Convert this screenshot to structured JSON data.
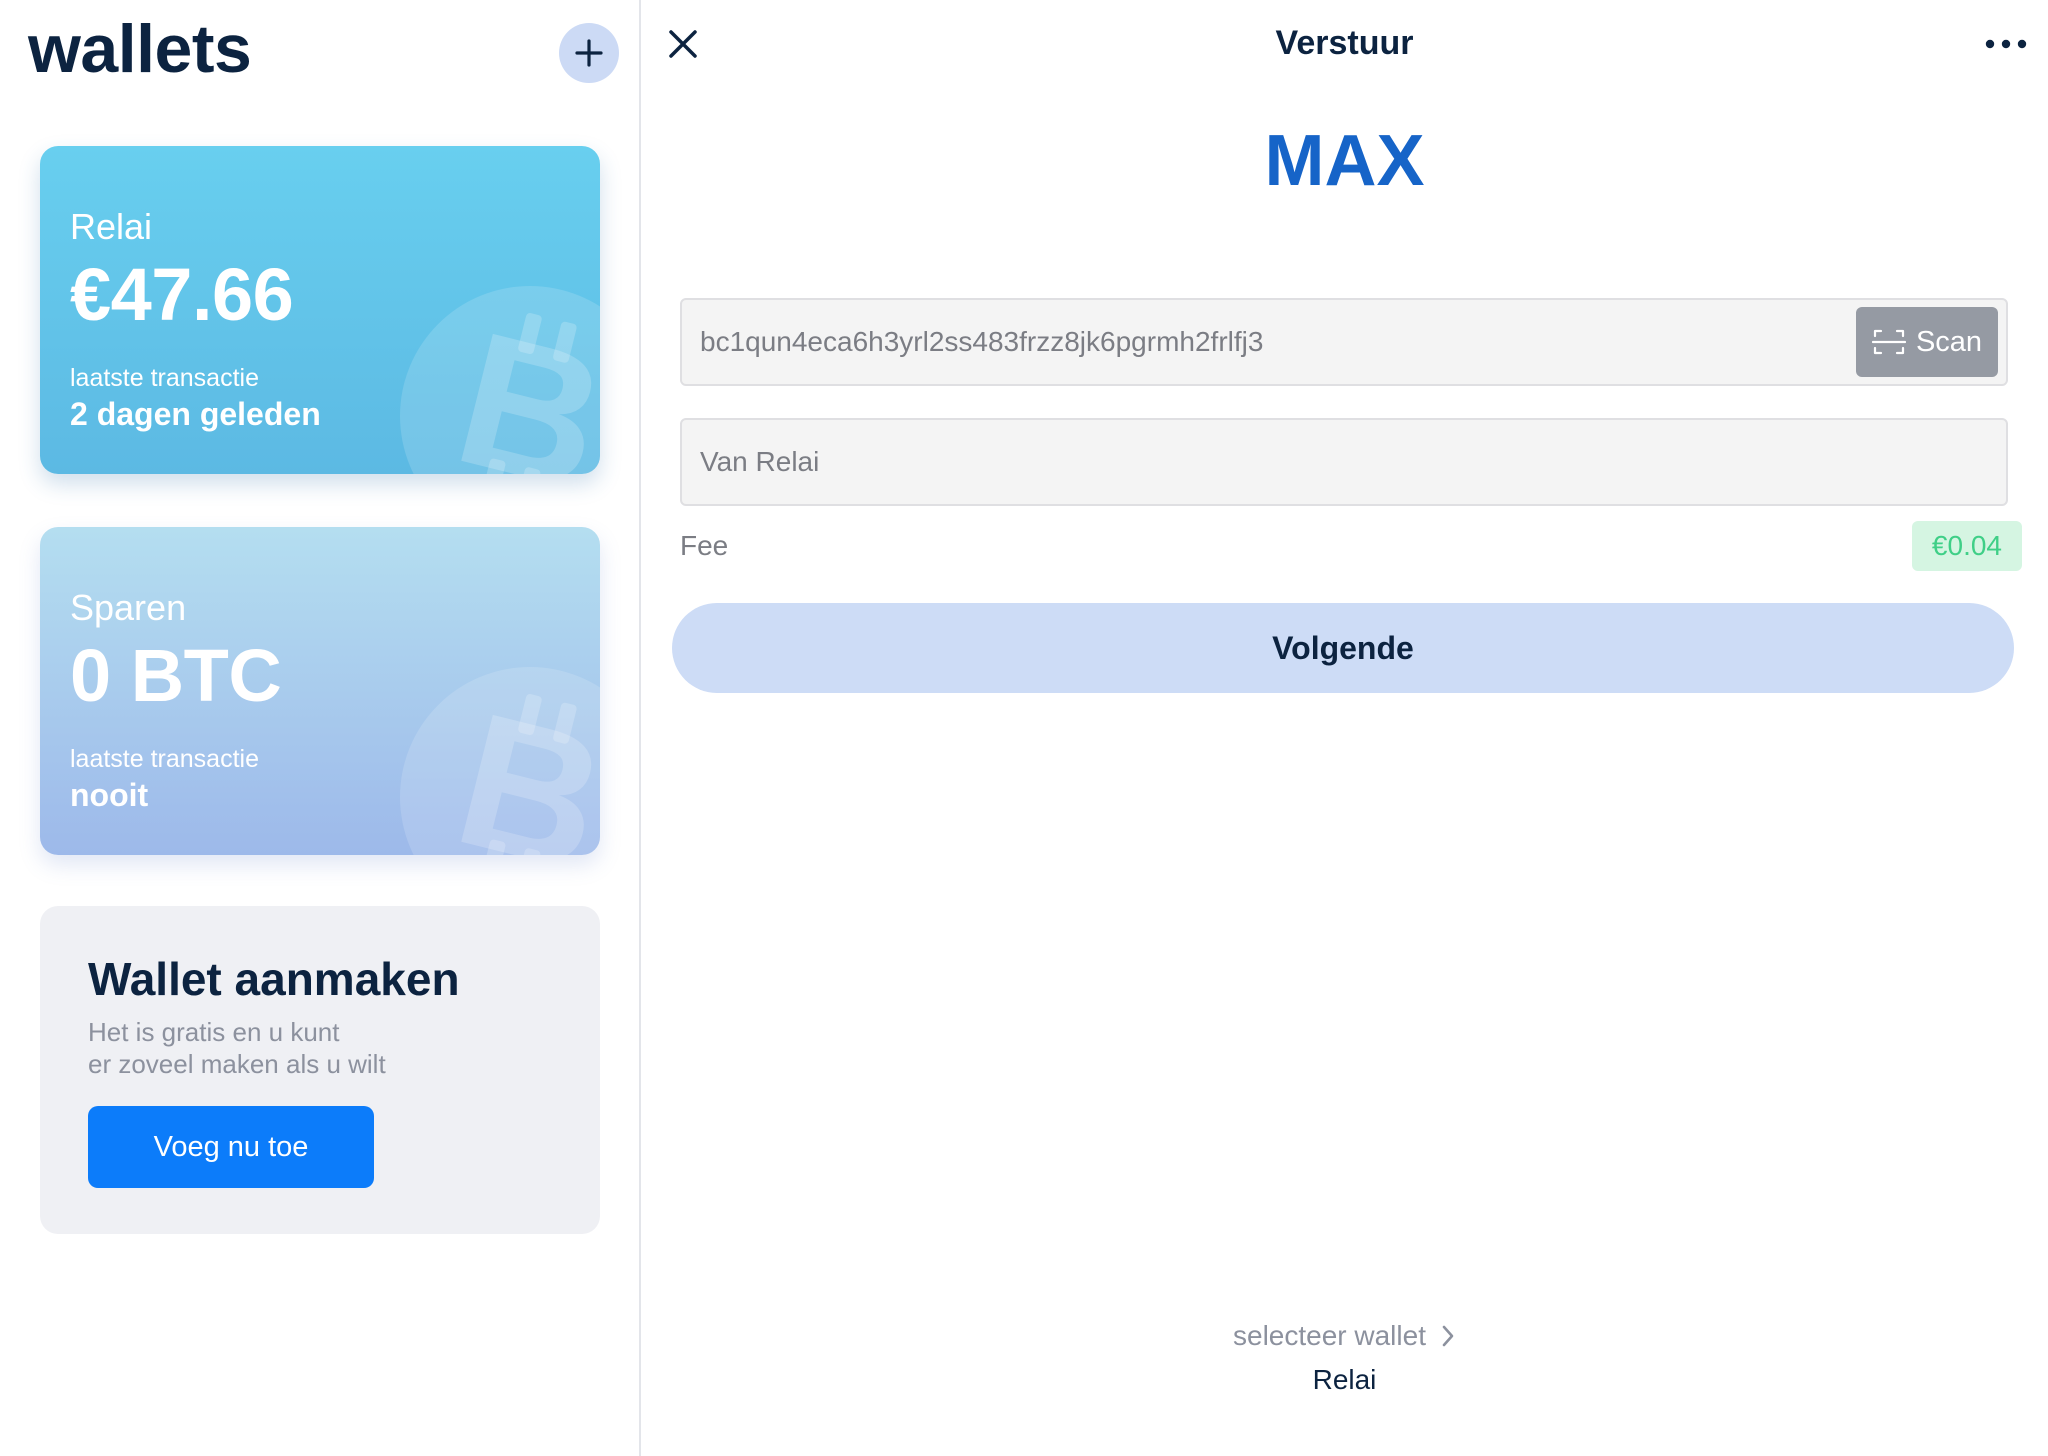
{
  "sidebar": {
    "title": "wallets",
    "add_icon": "plus-icon",
    "wallets": [
      {
        "name": "Relai",
        "amount": "€47.66",
        "last_tx_label": "laatste transactie",
        "last_tx_value": "2 dagen geleden",
        "watermark_icon": "bitcoin-icon",
        "color": "#62c5ec"
      },
      {
        "name": "Sparen",
        "amount": "0 BTC",
        "last_tx_label": "laatste transactie",
        "last_tx_value": "nooit",
        "watermark_icon": "bitcoin-icon",
        "color": "#a9cbed"
      }
    ],
    "create": {
      "title": "Wallet aanmaken",
      "desc_line1": "Het is gratis en u kunt",
      "desc_line2": "er zoveel maken als u wilt",
      "button_label": "Voeg nu toe"
    }
  },
  "send": {
    "title": "Verstuur",
    "close_icon": "close-icon",
    "more_icon": "more-horizontal-icon",
    "amount": "MAX",
    "address_value": "bc1qun4eca6h3yrl2ss483frzz8jk6pgrmh2frlfj3",
    "scan_label": "Scan",
    "scan_icon": "scan-icon",
    "from_value": "Van Relai",
    "fee_label": "Fee",
    "fee_value": "€0.04",
    "next_label": "Volgende",
    "select_wallet_label": "selecteer wallet",
    "select_wallet_icon": "chevron-right-icon",
    "selected_wallet": "Relai"
  },
  "colors": {
    "accent": "#1664c8",
    "primary_button": "#0c7cfa",
    "dark_text": "#0c2340",
    "fee_green": "#3fcf87"
  }
}
